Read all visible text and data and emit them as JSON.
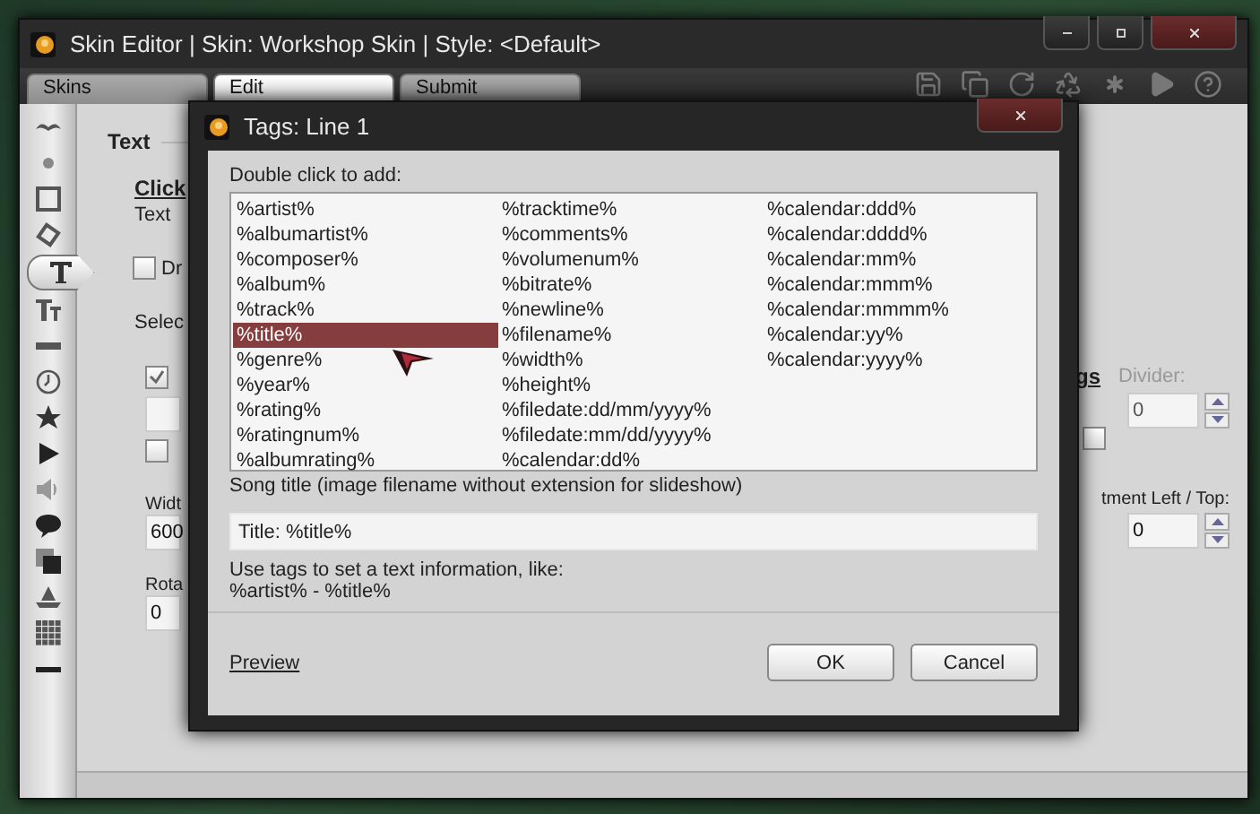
{
  "window": {
    "title": "Skin Editor | Skin: Workshop Skin | Style: <Default>"
  },
  "tabs": [
    {
      "label": "Skins",
      "selected": false
    },
    {
      "label": "Edit",
      "selected": true
    },
    {
      "label": "Submit",
      "selected": false
    }
  ],
  "tools": [
    {
      "selected": false
    },
    {
      "selected": false
    },
    {
      "selected": false
    },
    {
      "selected": false
    },
    {
      "selected": true
    },
    {
      "selected": false
    },
    {
      "selected": false
    },
    {
      "selected": false
    },
    {
      "selected": false
    },
    {
      "selected": false
    },
    {
      "selected": false
    },
    {
      "selected": false
    },
    {
      "selected": false
    },
    {
      "selected": false
    },
    {
      "selected": false
    },
    {
      "selected": false
    }
  ],
  "editor": {
    "heading": "Text",
    "link": "Click",
    "text_label": "Text",
    "draw_option": {
      "label": "Dr",
      "checked": false
    },
    "select_label": "Selec",
    "option_a": {
      "checked": true
    },
    "option_b": {
      "checked": false
    },
    "width": {
      "label": "Widt",
      "value": "600"
    },
    "rotation": {
      "label": "Rota",
      "value": "0"
    },
    "right": {
      "link": "gs",
      "divider": {
        "label": "Divider:",
        "value": "0",
        "disabled": true
      },
      "option": {
        "checked": false
      },
      "alignment": {
        "label": "tment Left / Top:",
        "value": "0"
      }
    }
  },
  "dialog": {
    "title": "Tags: Line 1",
    "list_label": "Double click to add:",
    "tag_columns": [
      {
        "items": [
          {
            "label": "%artist%",
            "selected": false
          },
          {
            "label": "%albumartist%",
            "selected": false
          },
          {
            "label": "%composer%",
            "selected": false
          },
          {
            "label": "%album%",
            "selected": false
          },
          {
            "label": "%track%",
            "selected": false
          },
          {
            "label": "%title%",
            "selected": true
          },
          {
            "label": "%genre%",
            "selected": false
          },
          {
            "label": "%year%",
            "selected": false
          },
          {
            "label": "%rating%",
            "selected": false
          },
          {
            "label": "%ratingnum%",
            "selected": false
          },
          {
            "label": "%albumrating%",
            "selected": false
          }
        ]
      },
      {
        "items": [
          {
            "label": "%tracktime%",
            "selected": false
          },
          {
            "label": "%comments%",
            "selected": false
          },
          {
            "label": "%volumenum%",
            "selected": false
          },
          {
            "label": "%bitrate%",
            "selected": false
          },
          {
            "label": "%newline%",
            "selected": false
          },
          {
            "label": "%filename%",
            "selected": false
          },
          {
            "label": "%width%",
            "selected": false
          },
          {
            "label": "%height%",
            "selected": false
          },
          {
            "label": "%filedate:dd/mm/yyyy%",
            "selected": false
          },
          {
            "label": "%filedate:mm/dd/yyyy%",
            "selected": false
          },
          {
            "label": "%calendar:dd%",
            "selected": false
          }
        ]
      },
      {
        "items": [
          {
            "label": "%calendar:ddd%",
            "selected": false
          },
          {
            "label": "%calendar:dddd%",
            "selected": false
          },
          {
            "label": "%calendar:mm%",
            "selected": false
          },
          {
            "label": "%calendar:mmm%",
            "selected": false
          },
          {
            "label": "%calendar:mmmm%",
            "selected": false
          },
          {
            "label": "%calendar:yy%",
            "selected": false
          },
          {
            "label": "%calendar:yyyy%",
            "selected": false
          }
        ]
      }
    ],
    "description": "Song title (image filename without extension for slideshow)",
    "value": "Title: %title%",
    "hint_lines": [
      "Use tags to set a text information, like:",
      "%artist% - %title%"
    ],
    "preview_link": "Preview",
    "buttons": [
      "OK",
      "Cancel"
    ]
  }
}
